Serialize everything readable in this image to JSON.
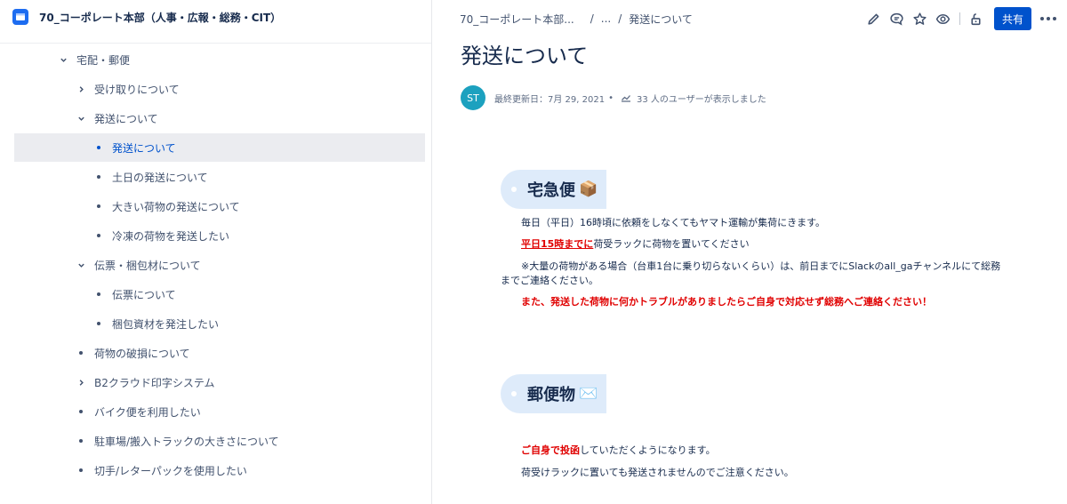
{
  "space": {
    "title": "70_コーポレート本部（人事・広報・総務・CIT）"
  },
  "sidebar": {
    "items": [
      {
        "label": "宅配・郵便"
      },
      {
        "label": "受け取りについて"
      },
      {
        "label": "発送について"
      },
      {
        "label": "発送について"
      },
      {
        "label": "土日の発送について"
      },
      {
        "label": "大きい荷物の発送について"
      },
      {
        "label": "冷凍の荷物を発送したい"
      },
      {
        "label": "伝票・梱包材について"
      },
      {
        "label": "伝票について"
      },
      {
        "label": "梱包資材を発注したい"
      },
      {
        "label": "荷物の破損について"
      },
      {
        "label": "B2クラウド印字システム"
      },
      {
        "label": "バイク便を利用したい"
      },
      {
        "label": "駐車場/搬入トラックの大きさについて"
      },
      {
        "label": "切手/レターパックを使用したい"
      }
    ]
  },
  "breadcrumb": {
    "item1": "70_コーポレート本部...",
    "sep": "/",
    "item2": "...",
    "item3": "発送について"
  },
  "toolbar": {
    "share_label": "共有"
  },
  "page": {
    "title": "発送について",
    "avatar_initials": "ST",
    "last_updated": "最終更新日：7月 29, 2021",
    "separator": "•",
    "views": "33 人のユーザーが表示しました"
  },
  "section1": {
    "heading": "宅急便",
    "emoji": "📦",
    "line1": "毎日（平日）16時頃に依頼をしなくてもヤマト運輸が集荷にきます。",
    "line2_red": "平日15時までに",
    "line2_rest": "荷受ラックに荷物を置いてください",
    "line3": "※大量の荷物がある場合（台車1台に乗り切らないくらい）は、前日までにSlackのall_gaチャンネルにて総務",
    "line4": "までご連絡ください。",
    "line5": "また、発送した荷物に何かトラブルがありましたらご自身で対応せず総務へご連絡ください！"
  },
  "section2": {
    "heading": "郵便物",
    "emoji": "✉️",
    "line1_red": "ご自身で投函",
    "line1_rest": "していただくようになります。",
    "line2": "荷受けラックに置いても発送されませんのでご注意ください。"
  },
  "colors": {
    "accent": "#0052cc",
    "space_icon": "#1d6cf0",
    "avatar": "#1ca1bf",
    "heading_bg": "#deebfa",
    "warning_red": "#e00000"
  }
}
